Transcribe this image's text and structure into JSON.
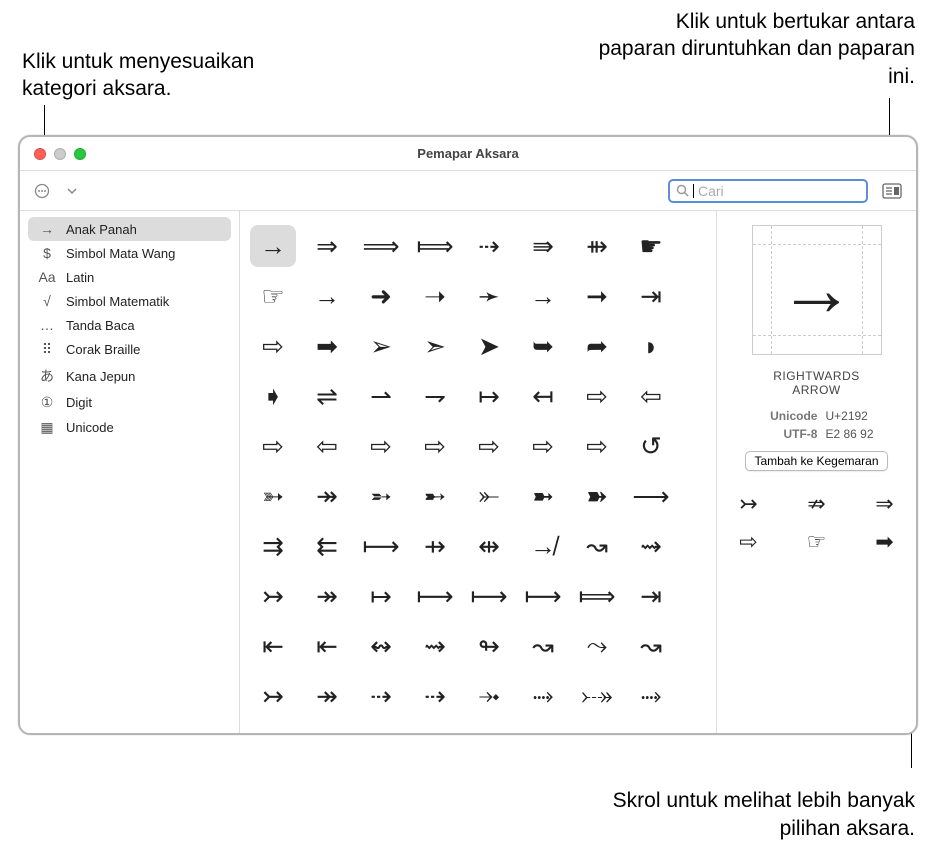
{
  "callouts": {
    "top_left": "Klik untuk menyesuaikan kategori aksara.",
    "top_right": "Klik untuk bertukar antara paparan diruntuhkan dan paparan ini.",
    "bottom_right": "Skrol untuk melihat lebih banyak pilihan aksara."
  },
  "window": {
    "title": "Pemapar Aksara",
    "search_placeholder": "Cari"
  },
  "sidebar": {
    "items": [
      {
        "icon": "→",
        "label": "Anak Panah",
        "selected": true
      },
      {
        "icon": "$",
        "label": "Simbol Mata Wang"
      },
      {
        "icon": "Aa",
        "label": "Latin"
      },
      {
        "icon": "√",
        "label": "Simbol Matematik"
      },
      {
        "icon": "…",
        "label": "Tanda Baca"
      },
      {
        "icon": "⠿",
        "label": "Corak Braille"
      },
      {
        "icon": "あ",
        "label": "Kana Jepun"
      },
      {
        "icon": "①",
        "label": "Digit"
      },
      {
        "icon": "▦",
        "label": "Unicode"
      }
    ]
  },
  "grid": {
    "chars": [
      "→",
      "⇒",
      "⟹",
      "⟾",
      "⇢",
      "⇛",
      "⇻",
      "☛",
      "☞",
      "→",
      "➜",
      "➝",
      "➛",
      "→",
      "➞",
      "⇥",
      "⇨",
      "➡",
      "➢",
      "➣",
      "➤",
      "➥",
      "➦",
      "◗",
      "➧",
      "⇌",
      "⇀",
      "⇁",
      "↦",
      "↤",
      "⇨",
      "⇦",
      "⇨",
      "⇦",
      "⇨",
      "⇨",
      "⇨",
      "⇨",
      "⇨",
      "↺",
      "➳",
      "↠",
      "➵",
      "➸",
      "⤜",
      "➼",
      "➽",
      "⟶",
      "⇉",
      "⇇",
      "⟼",
      "⇸",
      "⇹",
      "↛",
      "↝",
      "⇝",
      "↣",
      "↠",
      "↦",
      "⟼",
      "⟼",
      "⟼",
      "⟾",
      "⇥",
      "⇤",
      "⇤",
      "↭",
      "⇝",
      "↬",
      "↝",
      "⤳",
      "↝",
      "↣",
      "↠",
      "⇢",
      "⇢",
      "⤞",
      "⤑",
      "⤐",
      "⤑"
    ],
    "selected_index": 0
  },
  "detail": {
    "preview": "→",
    "name_line1": "RIGHTWARDS",
    "name_line2": "ARROW",
    "unicode_label": "Unicode",
    "unicode_value": "U+2192",
    "utf8_label": "UTF-8",
    "utf8_value": "E2 86 92",
    "favorite_btn": "Tambah ke Kegemaran",
    "variants": [
      "↣",
      "⇏",
      "⇒",
      "⇨",
      "☞",
      "➡"
    ]
  }
}
